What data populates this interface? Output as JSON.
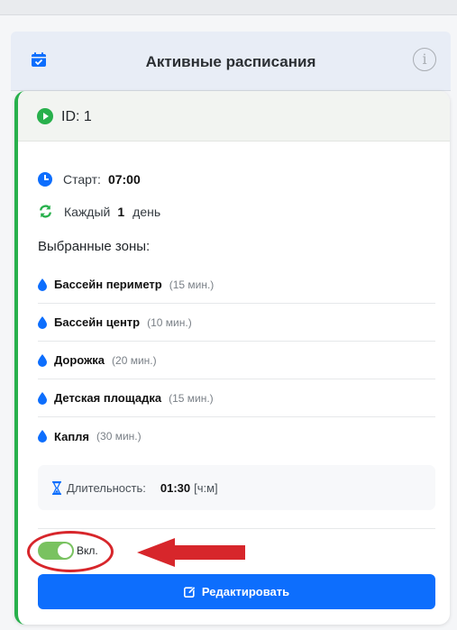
{
  "header": {
    "title": "Активные расписания",
    "calendar_icon": "calendar-check-icon",
    "info_icon": "info-circle-icon",
    "info_glyph": "i"
  },
  "schedule": {
    "id_label": "ID: 1",
    "status_icon": "play-circle-icon",
    "accent_color": "#28b04c",
    "start_label": "Старт:",
    "start_value": "07:00",
    "every_label": "Каждый",
    "every_value": "1",
    "every_unit": "день",
    "zones_title": "Выбранные зоны:",
    "zones": [
      {
        "name": "Бассейн периметр",
        "time": "(15 мин.)"
      },
      {
        "name": "Бассейн центр",
        "time": "(10 мин.)"
      },
      {
        "name": "Дорожка",
        "time": "(20 мин.)"
      },
      {
        "name": "Детская площадка",
        "time": "(15 мин.)"
      },
      {
        "name": "Капля",
        "time": "(30 мин.)"
      }
    ],
    "duration_label": "Длительность:",
    "duration_value": "01:30",
    "duration_unit": "[ч:м]",
    "toggle_label": "Вкл.",
    "toggle_on": true,
    "edit_label": "Редактировать"
  },
  "colors": {
    "primary": "#0d6efd",
    "success": "#28b04c",
    "annotation": "#d7262b"
  }
}
